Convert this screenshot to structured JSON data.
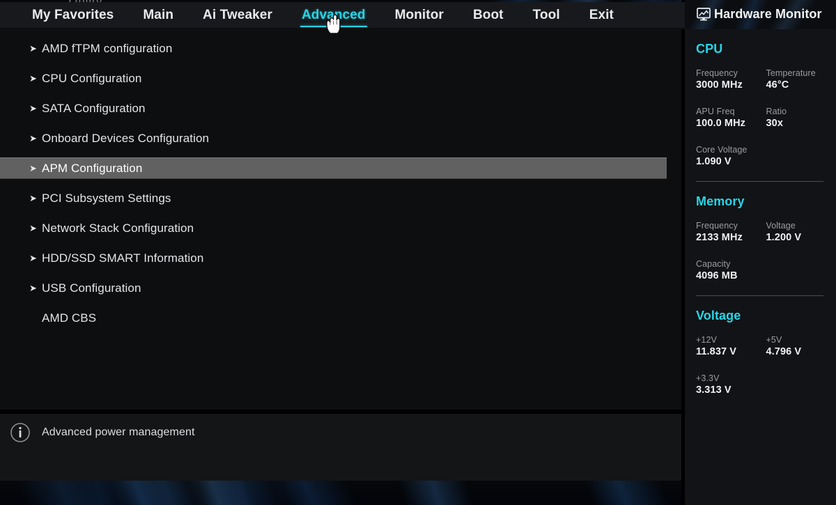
{
  "window": {
    "clipped_title": "Utility",
    "background_accent": "#2ad4e6"
  },
  "nav": {
    "tabs": [
      {
        "label": "My Favorites",
        "active": false
      },
      {
        "label": "Main",
        "active": false
      },
      {
        "label": "Ai Tweaker",
        "active": false
      },
      {
        "label": "Advanced",
        "active": true
      },
      {
        "label": "Monitor",
        "active": false
      },
      {
        "label": "Boot",
        "active": false
      },
      {
        "label": "Tool",
        "active": false
      },
      {
        "label": "Exit",
        "active": false
      }
    ],
    "cursor_icon": "pointing-hand-cursor"
  },
  "menu": {
    "arrow_glyph": "➤",
    "items": [
      {
        "label": "AMD fTPM configuration",
        "has_arrow": true,
        "selected": false
      },
      {
        "label": "CPU Configuration",
        "has_arrow": true,
        "selected": false
      },
      {
        "label": "SATA Configuration",
        "has_arrow": true,
        "selected": false
      },
      {
        "label": "Onboard Devices Configuration",
        "has_arrow": true,
        "selected": false
      },
      {
        "label": "APM Configuration",
        "has_arrow": true,
        "selected": true
      },
      {
        "label": "PCI Subsystem Settings",
        "has_arrow": true,
        "selected": false
      },
      {
        "label": "Network Stack Configuration",
        "has_arrow": true,
        "selected": false
      },
      {
        "label": "HDD/SSD SMART Information",
        "has_arrow": true,
        "selected": false
      },
      {
        "label": "USB Configuration",
        "has_arrow": true,
        "selected": false
      },
      {
        "label": "AMD CBS",
        "has_arrow": false,
        "selected": false
      }
    ],
    "highlight_color": "#616161"
  },
  "infobar": {
    "icon": "info-circle-icon",
    "text": "Advanced power management"
  },
  "hardware_monitor": {
    "title": "Hardware Monitor",
    "icon": "hardware-monitor-icon",
    "sections": [
      {
        "heading": "CPU",
        "rows": [
          [
            {
              "key": "Frequency",
              "value": "3000 MHz"
            },
            {
              "key": "Temperature",
              "value": "46°C"
            }
          ],
          [
            {
              "key": "APU Freq",
              "value": "100.0 MHz"
            },
            {
              "key": "Ratio",
              "value": "30x"
            }
          ],
          [
            {
              "key": "Core Voltage",
              "value": "1.090 V"
            }
          ]
        ]
      },
      {
        "heading": "Memory",
        "rows": [
          [
            {
              "key": "Frequency",
              "value": "2133 MHz"
            },
            {
              "key": "Voltage",
              "value": "1.200 V"
            }
          ],
          [
            {
              "key": "Capacity",
              "value": "4096 MB"
            }
          ]
        ]
      },
      {
        "heading": "Voltage",
        "rows": [
          [
            {
              "key": "+12V",
              "value": "11.837 V"
            },
            {
              "key": "+5V",
              "value": "4.796 V"
            }
          ],
          [
            {
              "key": "+3.3V",
              "value": "3.313 V"
            }
          ]
        ]
      }
    ]
  }
}
